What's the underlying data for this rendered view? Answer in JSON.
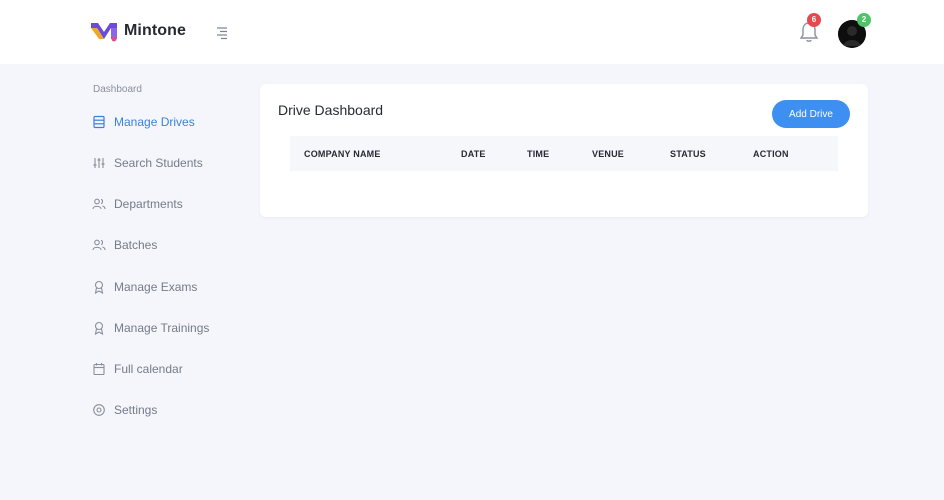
{
  "app": {
    "name": "Mintone"
  },
  "header": {
    "notifications_count": "6",
    "avatar_badge": "2"
  },
  "sidebar": {
    "heading": "Dashboard",
    "items": [
      {
        "label": "Manage Drives",
        "icon": "list-icon",
        "active": true
      },
      {
        "label": "Search Students",
        "icon": "sliders-icon"
      },
      {
        "label": "Departments",
        "icon": "users-icon"
      },
      {
        "label": "Batches",
        "icon": "users-icon"
      },
      {
        "label": "Manage Exams",
        "icon": "award-icon"
      },
      {
        "label": "Manage Trainings",
        "icon": "award-icon"
      },
      {
        "label": "Full calendar",
        "icon": "calendar-icon"
      },
      {
        "label": "Settings",
        "icon": "gear-icon"
      }
    ]
  },
  "main": {
    "card_title": "Drive Dashboard",
    "add_button_label": "Add Drive",
    "table": {
      "columns": [
        "COMPANY NAME",
        "DATE",
        "TIME",
        "VENUE",
        "STATUS",
        "ACTION"
      ],
      "rows": []
    }
  },
  "colors": {
    "accent": "#3d8ff2",
    "active_nav": "#3d7fe0",
    "background": "#f4f6fb",
    "notification_badge": "#e5484d",
    "avatar_badge": "#4fc36a"
  }
}
